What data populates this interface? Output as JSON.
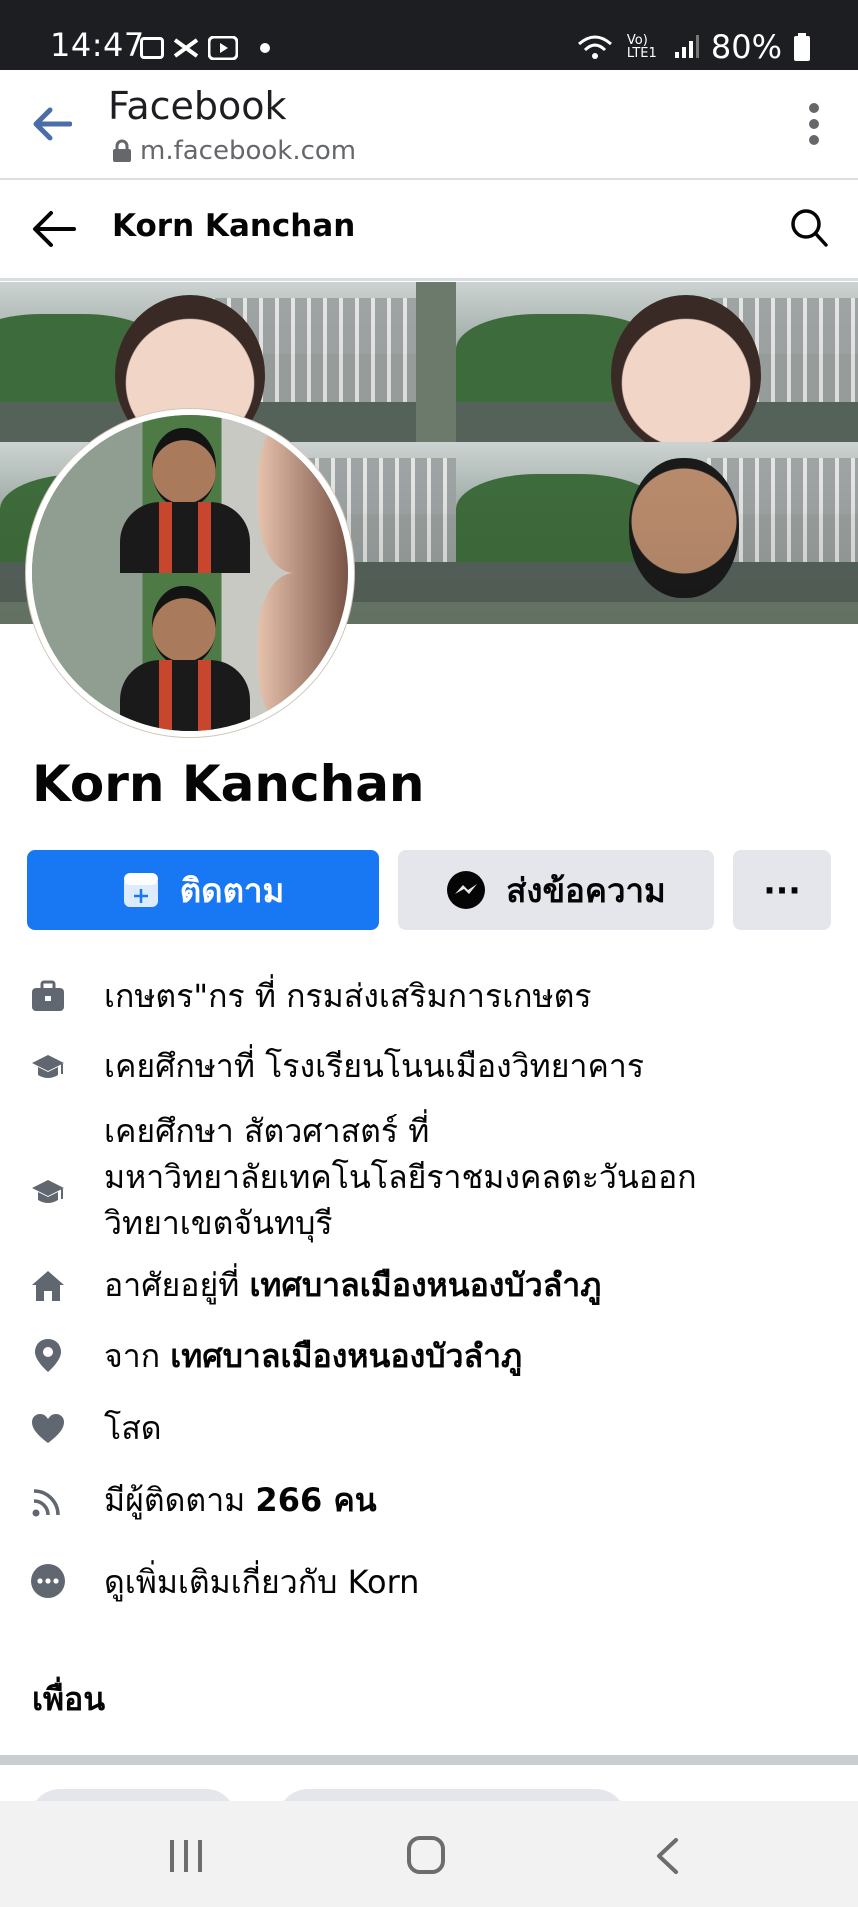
{
  "status_bar": {
    "time": "14:47",
    "battery": "80%",
    "net_label": "Vo) LTE1"
  },
  "browser": {
    "title": "Facebook",
    "url": "m.facebook.com"
  },
  "header": {
    "name": "Korn Kanchan"
  },
  "profile": {
    "name": "Korn Kanchan",
    "follow_label": "ติดตาม",
    "message_label": "ส่งข้อความ",
    "more_label": "···"
  },
  "intro": {
    "work": "เกษตร\"กร ที่ กรมส่งเสริมการเกษตร",
    "edu1": "เคยศึกษาที่ โรงเรียนโนนเมืองวิทยาคาร",
    "edu2_line1": "เคยศึกษา สัตวศาสตร์ ที่",
    "edu2_line2": "มหาวิทยาลัยเทคโนโลยีราชมงคลตะวันออก",
    "edu2_line3": "วิทยาเขตจันทบุรี",
    "lives_prefix": "อาศัยอยู่ที่ ",
    "lives_place": "เทศบาลเมืองหนองบัวลำภู",
    "from_prefix": "จาก ",
    "from_place": "เทศบาลเมืองหนองบัวลำภู",
    "relationship": "โสด",
    "followers_prefix": "มีผู้ติดตาม ",
    "followers_count": "266 คน",
    "see_more": "ดูเพิ่มเติมเกี่ยวกับ Korn"
  },
  "friends_title": "เพื่อน",
  "colors": {
    "fb_blue": "#1877f2",
    "button_gray": "#e4e6eb",
    "icon_gray": "#606770"
  }
}
